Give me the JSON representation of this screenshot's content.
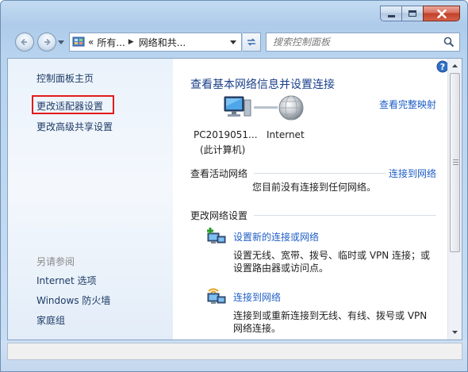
{
  "window": {
    "address": {
      "crumbs": [
        "所有...",
        "网络和共..."
      ],
      "prefix": "«"
    },
    "search": {
      "placeholder": "搜索控制面板"
    }
  },
  "sidebar": {
    "home": "控制面板主页",
    "links": [
      "更改适配器设置",
      "更改高级共享设置"
    ],
    "see_also_heading": "另请参阅",
    "see_also": [
      "Internet 选项",
      "Windows 防火墙",
      "家庭组"
    ]
  },
  "main": {
    "title": "查看基本网络信息并设置连接",
    "view_full_map": "查看完整映射",
    "computer_name": "PC2019051...",
    "computer_sub": "(此计算机)",
    "internet_label": "Internet",
    "active_networks_heading": "查看活动网络",
    "connect_to_network_link": "连接到网络",
    "no_connection_text": "您目前没有连接到任何网络。",
    "change_settings_heading": "更改网络设置",
    "tasks": [
      {
        "icon": "new-connection-icon",
        "title": "设置新的连接或网络",
        "desc_line1": "设置无线、宽带、拨号、临时或 VPN 连接；或",
        "desc_line2": "设置路由器或访问点。"
      },
      {
        "icon": "connect-network-icon",
        "title": "连接到网络",
        "desc_line1": "连接到或重新连接到无线、有线、拨号或 VPN",
        "desc_line2": "网络连接。"
      }
    ]
  },
  "colors": {
    "link": "#1f5ec7",
    "title": "#1a3f8a",
    "highlight": "#e21b1b"
  }
}
